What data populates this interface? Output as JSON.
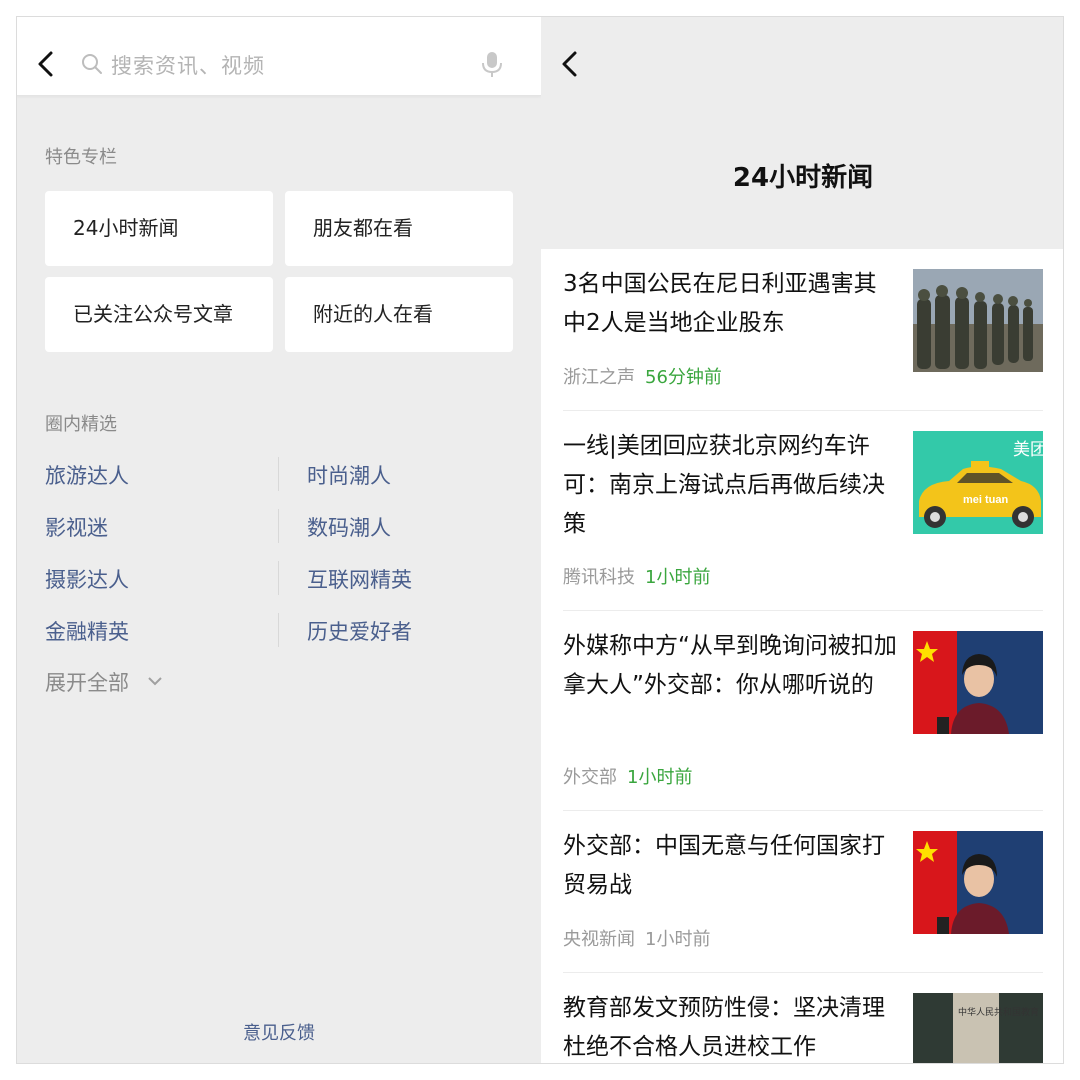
{
  "search": {
    "placeholder": "搜索资讯、视频"
  },
  "featured": {
    "title": "特色专栏",
    "items": [
      "24小时新闻",
      "朋友都在看",
      "已关注公众号文章",
      "附近的人在看"
    ]
  },
  "circle": {
    "title": "圈内精选",
    "left": [
      "旅游达人",
      "影视迷",
      "摄影达人",
      "金融精英"
    ],
    "right": [
      "时尚潮人",
      "数码潮人",
      "互联网精英",
      "历史爱好者"
    ],
    "expand_label": "展开全部"
  },
  "feedback_label": "意见反馈",
  "detail": {
    "title": "24小时新闻",
    "articles": [
      {
        "title": "3名中国公民在尼日利亚遇害其中2人是当地企业股东",
        "source": "浙江之声",
        "time": "56分钟前",
        "time_color": "#3aa63e"
      },
      {
        "title": "一线|美团回应获北京网约车许可：南京上海试点后再做后续决策",
        "source": "腾讯科技",
        "time": "1小时前",
        "time_color": "#3aa63e",
        "thumb_text": "美团",
        "thumb_badge": "mei tuan"
      },
      {
        "title": "外媒称中方“从早到晚询问被扣加拿大人”外交部：你从哪听说的",
        "source": "外交部",
        "time": "1小时前",
        "time_color": "#3aa63e"
      },
      {
        "title": "外交部：中国无意与任何国家打贸易战",
        "source": "央视新闻",
        "time": "1小时前",
        "time_color": "#9a9a9a"
      },
      {
        "title": "教育部发文预防性侵：坚决清理杜绝不合格人员进校工作",
        "source": "",
        "time": "",
        "thumb_text": "中华人民共和国教育"
      }
    ]
  },
  "colors": {
    "accent_green": "#3aa63e",
    "link_blue": "#4a5f8d",
    "panel_gray": "#ededed"
  }
}
